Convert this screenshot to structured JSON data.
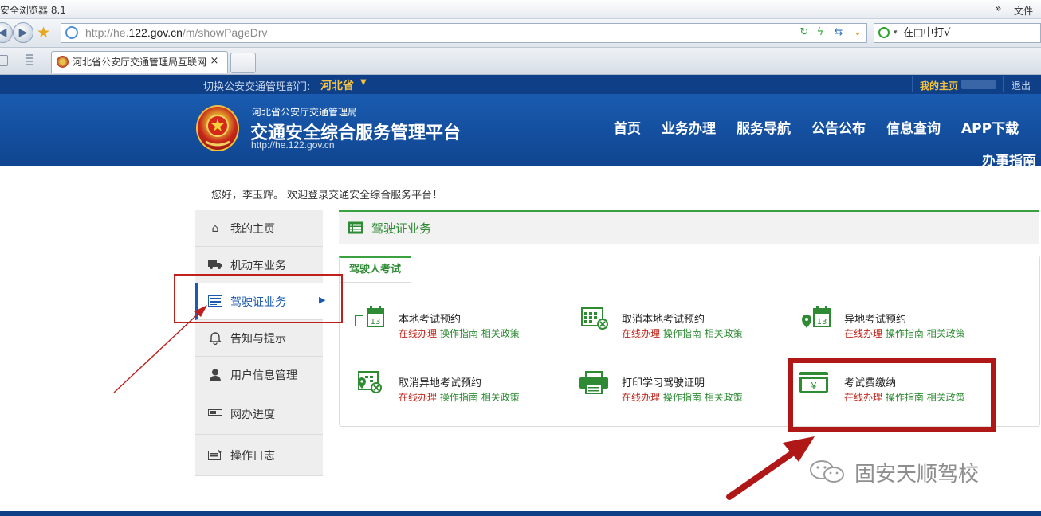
{
  "browser": {
    "title": "安全浏览器 8.1",
    "menu_overflow": "»",
    "menu_file": "文件",
    "url_host_prefix": "http://he.",
    "url_host_main": "122.gov.cn",
    "url_path": "/m/showPageDrv",
    "search_text": "在□中打√",
    "tab_title": "河北省公安厅交通管理局互联网",
    "tab_close": "×"
  },
  "site": {
    "switch_label": "切换公安交通管理部门:",
    "switch_value": "河北省",
    "my_home": "我的主页",
    "logout": "退出",
    "org_name": "河北省公安厅交通管理局",
    "platform_name": "交通安全综合服务管理平台",
    "site_url": "http://he.122.gov.cn",
    "nav": [
      "首页",
      "业务办理",
      "服务导航",
      "公告公布",
      "信息查询",
      "APP下载"
    ],
    "nav_second_row": "办事指南"
  },
  "greeting": "您好，李玉辉。 欢迎登录交通安全综合服务平台！",
  "sidebar": {
    "items": [
      {
        "label": "我的主页",
        "icon": "home-icon"
      },
      {
        "label": "机动车业务",
        "icon": "truck-icon"
      },
      {
        "label": "驾驶证业务",
        "icon": "list-card-icon",
        "active": true
      },
      {
        "label": "告知与提示",
        "icon": "bell-icon"
      },
      {
        "label": "用户信息管理",
        "icon": "user-icon"
      },
      {
        "label": "网办进度",
        "icon": "progress-icon"
      },
      {
        "label": "操作日志",
        "icon": "log-icon"
      }
    ]
  },
  "main": {
    "section_title": "驾驶证业务",
    "subtab": "驾驶人考试",
    "link_online": "在线办理",
    "link_guide": "操作指南",
    "link_policy": "相关政策",
    "services": [
      {
        "title": "本地考试预约",
        "icon": "calendar-13-icon"
      },
      {
        "title": "取消本地考试预约",
        "icon": "calendar-cancel-icon"
      },
      {
        "title": "异地考试预约",
        "icon": "calendar-location-icon"
      },
      {
        "title": "取消异地考试预约",
        "icon": "calendar-location-cancel-icon"
      },
      {
        "title": "打印学习驾驶证明",
        "icon": "printer-icon"
      },
      {
        "title": "考试费缴纳",
        "icon": "yuan-card-icon"
      }
    ]
  },
  "watermark": "固安天顺驾校",
  "colors": {
    "header_blue": "#1a5bb0",
    "accent_green": "#3aa040",
    "annotation_red": "#b01818",
    "switch_gold": "#f5c242"
  }
}
